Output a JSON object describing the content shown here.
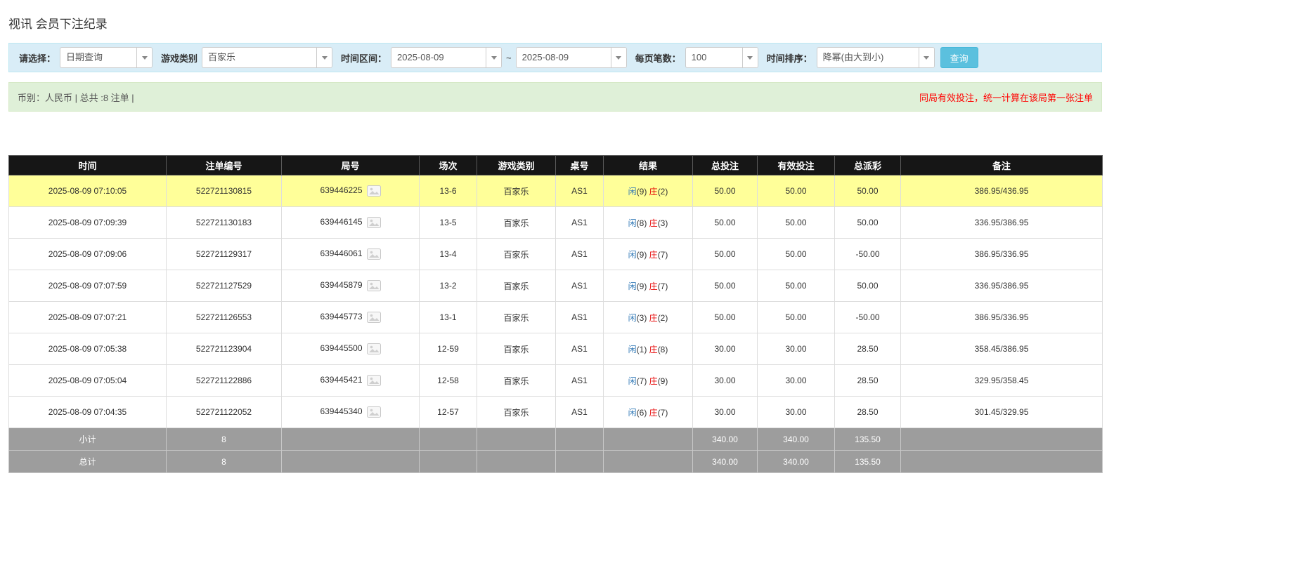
{
  "page": {
    "title": "视讯 会员下注纪录"
  },
  "filters": {
    "select_label": "请选择：",
    "select_value": "日期查询",
    "game_type_label": "游戏类别",
    "game_type_value": "百家乐",
    "time_range_label": "时间区间：",
    "date_from": "2025-08-09",
    "tilde": "~",
    "date_to": "2025-08-09",
    "per_page_label": "每页笔数：",
    "per_page_value": "100",
    "sort_label": "时间排序：",
    "sort_value": "降幂(由大到小)",
    "search_button": "查询"
  },
  "summary": {
    "left": "币别：人民币 | 总共 :8 注单 |",
    "right_note": "同局有效投注，统一计算在该局第一张注单"
  },
  "table": {
    "headers": [
      "时间",
      "注单编号",
      "局号",
      "场次",
      "游戏类别",
      "桌号",
      "结果",
      "总投注",
      "有效投注",
      "总派彩",
      "备注"
    ],
    "rows": [
      {
        "time": "2025-08-09 07:10:05",
        "bet_id": "522721130815",
        "round": "639446225",
        "session": "13-6",
        "game_type": "百家乐",
        "table_no": "AS1",
        "result": {
          "player_label": "闲",
          "player_score": "(9)",
          "banker_label": "庄",
          "banker_score": "(2)"
        },
        "total_bet": "50.00",
        "valid_bet": "50.00",
        "payout": "50.00",
        "remark": "386.95/436.95",
        "highlight": true
      },
      {
        "time": "2025-08-09 07:09:39",
        "bet_id": "522721130183",
        "round": "639446145",
        "session": "13-5",
        "game_type": "百家乐",
        "table_no": "AS1",
        "result": {
          "player_label": "闲",
          "player_score": "(8)",
          "banker_label": "庄",
          "banker_score": "(3)"
        },
        "total_bet": "50.00",
        "valid_bet": "50.00",
        "payout": "50.00",
        "remark": "336.95/386.95",
        "highlight": false
      },
      {
        "time": "2025-08-09 07:09:06",
        "bet_id": "522721129317",
        "round": "639446061",
        "session": "13-4",
        "game_type": "百家乐",
        "table_no": "AS1",
        "result": {
          "player_label": "闲",
          "player_score": "(9)",
          "banker_label": "庄",
          "banker_score": "(7)"
        },
        "total_bet": "50.00",
        "valid_bet": "50.00",
        "payout": "-50.00",
        "remark": "386.95/336.95",
        "highlight": false
      },
      {
        "time": "2025-08-09 07:07:59",
        "bet_id": "522721127529",
        "round": "639445879",
        "session": "13-2",
        "game_type": "百家乐",
        "table_no": "AS1",
        "result": {
          "player_label": "闲",
          "player_score": "(9)",
          "banker_label": "庄",
          "banker_score": "(7)"
        },
        "total_bet": "50.00",
        "valid_bet": "50.00",
        "payout": "50.00",
        "remark": "336.95/386.95",
        "highlight": false
      },
      {
        "time": "2025-08-09 07:07:21",
        "bet_id": "522721126553",
        "round": "639445773",
        "session": "13-1",
        "game_type": "百家乐",
        "table_no": "AS1",
        "result": {
          "player_label": "闲",
          "player_score": "(3)",
          "banker_label": "庄",
          "banker_score": "(2)"
        },
        "total_bet": "50.00",
        "valid_bet": "50.00",
        "payout": "-50.00",
        "remark": "386.95/336.95",
        "highlight": false
      },
      {
        "time": "2025-08-09 07:05:38",
        "bet_id": "522721123904",
        "round": "639445500",
        "session": "12-59",
        "game_type": "百家乐",
        "table_no": "AS1",
        "result": {
          "player_label": "闲",
          "player_score": "(1)",
          "banker_label": "庄",
          "banker_score": "(8)"
        },
        "total_bet": "30.00",
        "valid_bet": "30.00",
        "payout": "28.50",
        "remark": "358.45/386.95",
        "highlight": false
      },
      {
        "time": "2025-08-09 07:05:04",
        "bet_id": "522721122886",
        "round": "639445421",
        "session": "12-58",
        "game_type": "百家乐",
        "table_no": "AS1",
        "result": {
          "player_label": "闲",
          "player_score": "(7)",
          "banker_label": "庄",
          "banker_score": "(9)"
        },
        "total_bet": "30.00",
        "valid_bet": "30.00",
        "payout": "28.50",
        "remark": "329.95/358.45",
        "highlight": false
      },
      {
        "time": "2025-08-09 07:04:35",
        "bet_id": "522721122052",
        "round": "639445340",
        "session": "12-57",
        "game_type": "百家乐",
        "table_no": "AS1",
        "result": {
          "player_label": "闲",
          "player_score": "(6)",
          "banker_label": "庄",
          "banker_score": "(7)"
        },
        "total_bet": "30.00",
        "valid_bet": "30.00",
        "payout": "28.50",
        "remark": "301.45/329.95",
        "highlight": false
      }
    ],
    "subtotal": {
      "label": "小计",
      "count": "8",
      "total_bet": "340.00",
      "valid_bet": "340.00",
      "payout": "135.50"
    },
    "total": {
      "label": "总计",
      "count": "8",
      "total_bet": "340.00",
      "valid_bet": "340.00",
      "payout": "135.50"
    }
  }
}
